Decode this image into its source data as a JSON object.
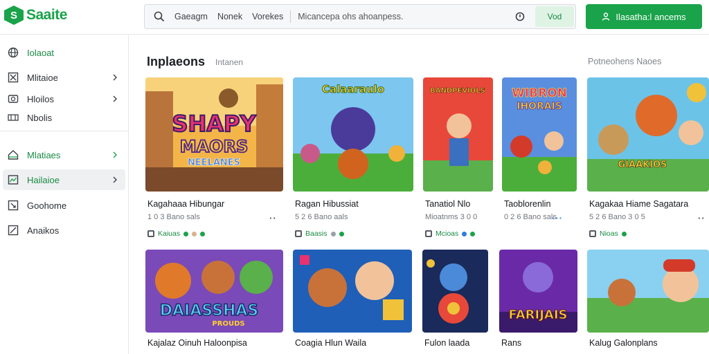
{
  "app": {
    "logo_text": "Saaite",
    "logo_glyph": "S"
  },
  "search": {
    "tabs": [
      "Gaeagm",
      "Nonek",
      "Vorekes"
    ],
    "placeholder": "Micancepa ohs ahoanpess.",
    "button_label": "Vod"
  },
  "cta": {
    "label": "Ilasatha:l ancems"
  },
  "sidebar": {
    "items": [
      {
        "label": "Iolaoat",
        "icon": "globe-icon",
        "chevron": false,
        "green": true,
        "active": false
      },
      {
        "label": "Mlitaioe",
        "icon": "grid-icon",
        "chevron": true,
        "green": false,
        "active": false
      },
      {
        "label": "Hloilos",
        "icon": "camera-icon",
        "chevron": true,
        "green": false,
        "active": false
      },
      {
        "label": "Nbolis",
        "icon": "film-icon",
        "chevron": false,
        "green": false,
        "active": false
      },
      {
        "label": "Mlatiaes",
        "icon": "home-icon",
        "chevron": true,
        "green": false,
        "active": false
      },
      {
        "label": "Hailaioe",
        "icon": "chart-icon",
        "chevron": true,
        "green": true,
        "active": true
      },
      {
        "label": "Goohome",
        "icon": "expand-icon",
        "chevron": false,
        "green": false,
        "active": false
      },
      {
        "label": "Anaikos",
        "icon": "edit-icon",
        "chevron": false,
        "green": false,
        "active": false
      }
    ]
  },
  "main": {
    "section_title": "Inplaeons",
    "section_sub": "Intanen",
    "section_right": "Potneohens Naoes",
    "row1": [
      {
        "title": "Kagahaaa Hibungar",
        "meta": "1 0 3 Bano sals",
        "tag": "Kaiuas",
        "thumb_text": [
          "SHAPY",
          "MAORS",
          "NEELANES"
        ]
      },
      {
        "title": "Ragan Hibussiat",
        "meta": "5 2 6 Bano aals",
        "tag": "Baasis",
        "thumb_text": [
          "Calaaraulo"
        ]
      },
      {
        "title": "Tanatiol Nlo",
        "meta": "Mioatnms 3 0 0",
        "tag": "Mcioas",
        "thumb_text": [
          "BANDPEVIOLS"
        ]
      },
      {
        "title": "Taoblorenlin",
        "meta": "0 2 6 Bano sals",
        "tag": "",
        "thumb_text": [
          "WIBRON",
          "IHORAIS"
        ]
      },
      {
        "title": "Kagakaa Hiame Sagatara",
        "meta": "5 2 6 Bano 3 0 5",
        "tag": "Nioas",
        "thumb_text": [
          "GIAAKIOS"
        ]
      }
    ],
    "row2": [
      {
        "title": "Kajalaz Oinuh Haloonpisa",
        "meta": "",
        "thumb_text": [
          "DAIASSHAS",
          "PROUDS"
        ]
      },
      {
        "title": "Coagia Hlun Waila",
        "meta": "",
        "thumb_text": []
      },
      {
        "title": "Fulon laada",
        "meta": "",
        "thumb_text": []
      },
      {
        "title": "Rans",
        "meta": "",
        "thumb_text": [
          "FARIJAIS"
        ]
      },
      {
        "title": "Kalug Galonplans",
        "meta": "",
        "thumb_text": []
      }
    ]
  },
  "colors": {
    "brand": "#1aa34a",
    "brand_light": "#dff3e4",
    "tag_dot_1": "#1aa34a",
    "tag_dot_2": "#9aa0a6",
    "tag_dot_3": "#2f7be0"
  }
}
